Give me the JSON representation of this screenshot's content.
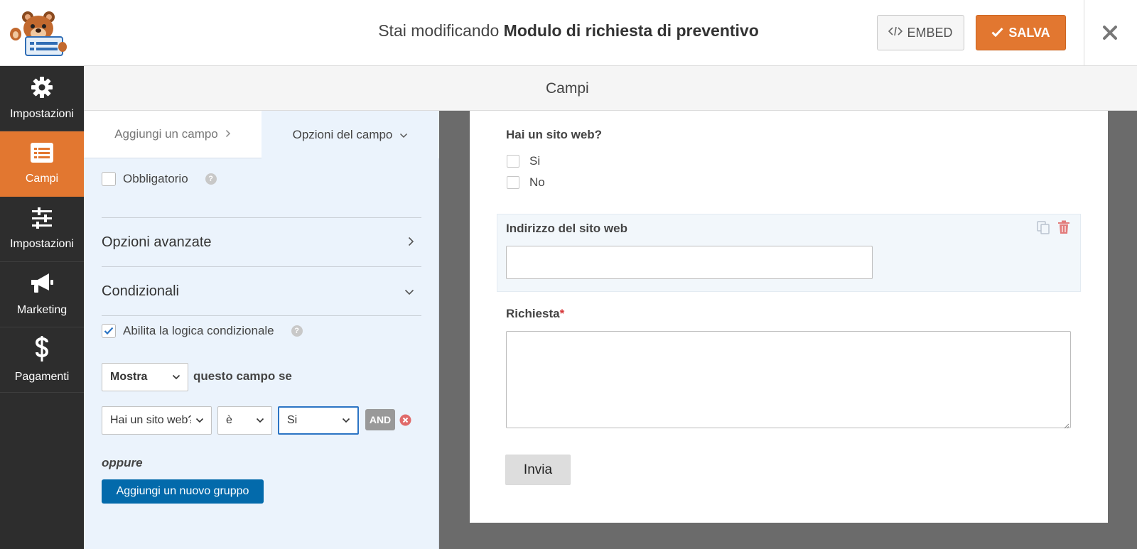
{
  "header": {
    "title_prefix": "Stai modificando",
    "form_name": "Modulo di richiesta di preventivo",
    "embed_label": "EMBED",
    "save_label": "SALVA"
  },
  "sidebar": {
    "items": [
      {
        "label": "Impostazioni",
        "icon": "gear-icon"
      },
      {
        "label": "Campi",
        "icon": "fields-list-icon",
        "active": true
      },
      {
        "label": "Impostazioni",
        "icon": "sliders-icon"
      },
      {
        "label": "Marketing",
        "icon": "megaphone-icon"
      },
      {
        "label": "Pagamenti",
        "icon": "dollar-icon"
      }
    ]
  },
  "subheader": {
    "title": "Campi"
  },
  "panel": {
    "tabs": {
      "add_field": "Aggiungi un campo",
      "field_options": "Opzioni del campo"
    },
    "required_label": "Obbligatorio",
    "advanced_options": "Opzioni avanzate",
    "conditionals": "Condizionali",
    "enable_logic_label": "Abilita la logica condizionale",
    "action_select": "Mostra",
    "action_suffix": "questo campo se",
    "rule": {
      "field": "Hai un sito web?",
      "operator": "è",
      "value": "Si",
      "and_label": "AND"
    },
    "or_label": "oppure",
    "add_group_label": "Aggiungi un nuovo gruppo"
  },
  "preview": {
    "q1_label": "Hai un sito web?",
    "q1_options": [
      "Si",
      "No"
    ],
    "website_label": "Indirizzo del sito web",
    "request_label": "Richiesta",
    "required_mark": "*",
    "submit_label": "Invia"
  },
  "colors": {
    "accent": "#e27730",
    "sidebar": "#2d2d2d",
    "panel": "#ebf3fc",
    "primary_button": "#036aab"
  }
}
